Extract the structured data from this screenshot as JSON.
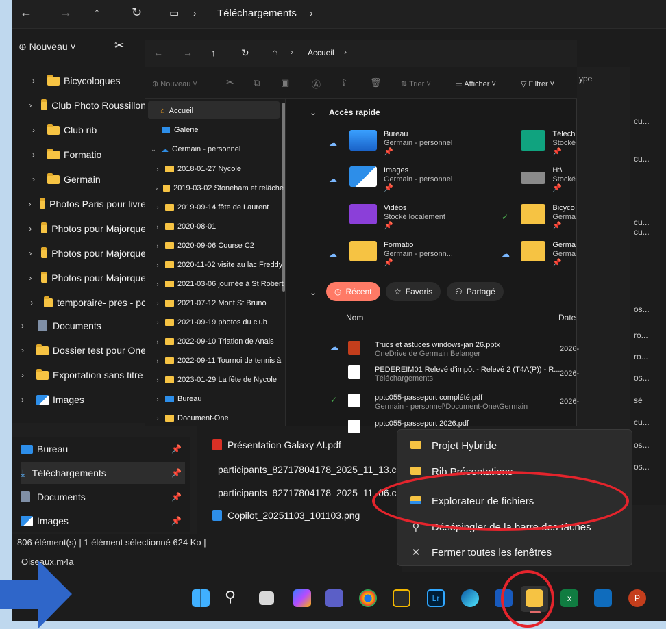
{
  "back_window": {
    "path": "Téléchargements",
    "new_label": "Nouveau",
    "tree": [
      "Bicycologues",
      "Club Photo Roussillon",
      "Club rib",
      "Formatio",
      "Germain",
      "Photos Paris pour livre",
      "Photos pour Majorque",
      "Photos pour Majorque",
      "Photos pour Majorque",
      "temporaire- pres - pc"
    ],
    "tree_l0": [
      "Documents",
      "Dossier test pour One",
      "Exportation sans titre",
      "Images"
    ],
    "pinned": [
      "Bureau",
      "Téléchargements",
      "Documents",
      "Images"
    ],
    "files": [
      "Présentation Galaxy AI.pdf",
      "participants_82717804178_2025_11_13.csv",
      "participants_82717804178_2025_11_06.csv",
      "Copilot_20251103_101103.png"
    ],
    "status": "806 élément(s)  |  1 élément sélectionné  624 Ko  |",
    "audio_file": "Oiseaux.m4a",
    "right_strip": [
      "cu...",
      "cu...",
      "cu...",
      "cu...",
      "os...",
      "ro...",
      "ro...",
      "os...",
      "sé",
      "cu...",
      "os...",
      "os..."
    ],
    "type_header": "ype"
  },
  "front_window": {
    "breadcrumb": "Accueil",
    "toolbar": {
      "new": "Nouveau",
      "sort": "Trier",
      "view": "Afficher",
      "filter": "Filtrer"
    },
    "nav": {
      "home": "Accueil",
      "gallery": "Galerie",
      "onedrive": "Germain - personnel",
      "folders": [
        "2018-01-27 Nycole",
        "2019-03-02 Stoneham et relâche",
        "2019-09-14 fête de Laurent",
        "2020-08-01",
        "2020-09-06 Course C2",
        "2020-11-02 visite au lac Freddy",
        "2021-03-06 journée à St Robert",
        "2021-07-12 Mont St Bruno",
        "2021-09-19 photos du club",
        "2022-09-10 Triatlon de Anais",
        "2022-09-11 Tournoi de tennis à",
        "2023-01-29 La fête de Nycole",
        "Bureau",
        "Document-One"
      ]
    },
    "quick_access": {
      "title": "Accès rapide",
      "items": [
        {
          "name": "Bureau",
          "sub": "Germain - personnel"
        },
        {
          "name": "Téléch",
          "sub": "Stocké"
        },
        {
          "name": "Images",
          "sub": "Germain - personnel"
        },
        {
          "name": "H:\\",
          "sub": "Stocké"
        },
        {
          "name": "Vidéos",
          "sub": "Stocké localement"
        },
        {
          "name": "Bicyco",
          "sub": "Germa"
        },
        {
          "name": "Formatio",
          "sub": "Germain - personn..."
        },
        {
          "name": "Germa",
          "sub": "Germa"
        }
      ]
    },
    "chips": {
      "recent": "Récent",
      "favorites": "Favoris",
      "shared": "Partagé"
    },
    "recent": {
      "col_name": "Nom",
      "col_date": "Date",
      "rows": [
        {
          "name": "Trucs et astuces windows-jan 26.pptx",
          "sub": "OneDrive de Germain Belanger",
          "date": "2026-"
        },
        {
          "name": "PEDEREIM01 Relevé d'impôt - Relevé 2 (T4A(P)) - R...",
          "sub": "Téléchargements",
          "date": "2026-"
        },
        {
          "name": "pptc055-passeport complété.pdf",
          "sub": "Germain - personnel\\Document-One\\Germain",
          "date": "2026-"
        },
        {
          "name": "pptc055-passeport 2026.pdf",
          "sub": "",
          "date": ""
        }
      ]
    }
  },
  "context_menu": {
    "items": [
      "Projet Hybride",
      "Rib Présentations",
      "Explorateur de fichiers",
      "Désépingler de la barre des tâches",
      "Fermer toutes les fenêtres"
    ]
  },
  "colors": {
    "annotation_red": "#e4242c",
    "arrow_blue": "#2f66c9",
    "folder_yellow": "#f6c343",
    "accent": "#ff7a66"
  }
}
